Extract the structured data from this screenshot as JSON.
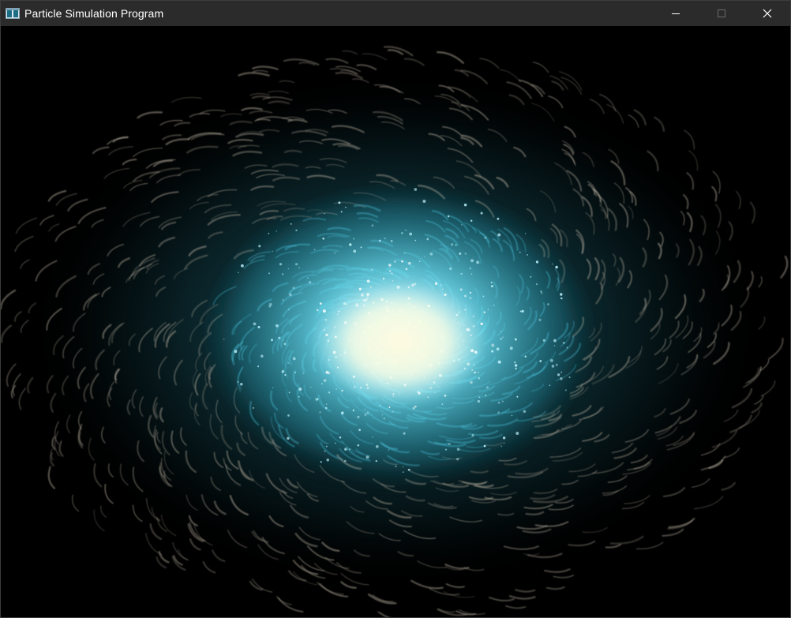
{
  "window": {
    "title": "Particle Simulation Program",
    "icon": "app-window-icon"
  },
  "controls": {
    "minimize_icon": "minimize-icon",
    "maximize_icon": "maximize-icon",
    "close_icon": "close-icon"
  },
  "scene": {
    "description_type": "spiral-galaxy-particle-swirl",
    "core_color": "#fffbe0",
    "glow_color": "#5ad8f0",
    "outer_color": "#2a7a8a",
    "trail_color": "#b9b0a0",
    "background_color": "#000000"
  }
}
